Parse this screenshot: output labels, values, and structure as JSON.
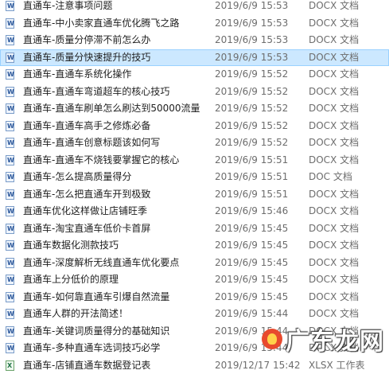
{
  "files": [
    {
      "name": "直通车-注意事项问题",
      "date": "2019/6/9 15:53",
      "type": "DOCX 文档",
      "icon": "word-doc-icon"
    },
    {
      "name": "直通车-中小卖家直通车优化腾飞之路",
      "date": "2019/6/9 15:53",
      "type": "DOCX 文档",
      "icon": "word-doc-icon"
    },
    {
      "name": "直通车-质量分停滞不前怎么办",
      "date": "2019/6/9 15:53",
      "type": "DOCX 文档",
      "icon": "word-doc-icon"
    },
    {
      "name": "直通车-质量分快速提升的技巧",
      "date": "2019/6/9 15:53",
      "type": "DOCX 文档",
      "icon": "word-doc-icon",
      "selected": true
    },
    {
      "name": "直通车-直通车系统化操作",
      "date": "2019/6/9 15:52",
      "type": "DOCX 文档",
      "icon": "word-doc-icon"
    },
    {
      "name": "直通车-直通车弯道超车的核心技巧",
      "date": "2019/6/9 15:52",
      "type": "DOCX 文档",
      "icon": "word-doc-icon"
    },
    {
      "name": "直通车-直通车刷单怎么刷达到50000流量",
      "date": "2019/6/9 15:52",
      "type": "DOCX 文档",
      "icon": "word-doc-icon"
    },
    {
      "name": "直通车-直通车高手之修炼必备",
      "date": "2019/6/9 15:52",
      "type": "DOCX 文档",
      "icon": "word-doc-icon"
    },
    {
      "name": "直通车-直通车创意标题该如何写",
      "date": "2019/6/9 15:52",
      "type": "DOCX 文档",
      "icon": "word-doc-icon"
    },
    {
      "name": "直通车-直通车不烧钱要掌握它的核心",
      "date": "2019/6/9 15:51",
      "type": "DOCX 文档",
      "icon": "word-doc-icon"
    },
    {
      "name": "直通车-怎么提高质量得分",
      "date": "2019/6/9 15:51",
      "type": "DOC 文档",
      "icon": "word-doc-icon"
    },
    {
      "name": "直通车-怎么把直通车开到极致",
      "date": "2019/6/9 15:51",
      "type": "DOCX 文档",
      "icon": "word-doc-icon"
    },
    {
      "name": "直通车优化这样做让店铺旺季",
      "date": "2019/6/9 15:46",
      "type": "DOCX 文档",
      "icon": "word-doc-icon"
    },
    {
      "name": "直通车-淘宝直通车低价卡首屏",
      "date": "2019/6/9 15:45",
      "type": "DOCX 文档",
      "icon": "word-doc-icon"
    },
    {
      "name": "直通车数据化测款技巧",
      "date": "2019/6/9 15:45",
      "type": "DOCX 文档",
      "icon": "word-doc-icon"
    },
    {
      "name": "直通车-深度解析无线直通车优化要点",
      "date": "2019/6/9 15:45",
      "type": "DOCX 文档",
      "icon": "word-doc-icon"
    },
    {
      "name": "直通车上分低价的原理",
      "date": "2019/6/9 15:45",
      "type": "DOCX 文档",
      "icon": "word-doc-icon"
    },
    {
      "name": "直通车-如何靠直通车引爆自然流量",
      "date": "2019/6/9 15:45",
      "type": "DOCX 文档",
      "icon": "word-doc-icon"
    },
    {
      "name": "直通车人群的开法简述！",
      "date": "2019/6/9 15:44",
      "type": "DOCX 文档",
      "icon": "word-doc-icon"
    },
    {
      "name": "直通车-关键词质量得分的基础知识",
      "date": "2019/6/9 15:44",
      "type": "DOCX 文档",
      "icon": "word-doc-icon"
    },
    {
      "name": "直通车-多种直通车选词技巧必学",
      "date": "2019/6/9 15:44",
      "type": "DOCX 文档",
      "icon": "word-doc-icon"
    },
    {
      "name": "直通车-店铺直通车数据登记表",
      "date": "2019/12/17 15:42",
      "type": "XLSX 工作表",
      "icon": "excel-sheet-icon"
    }
  ],
  "watermark": {
    "text": "广东龙网"
  }
}
